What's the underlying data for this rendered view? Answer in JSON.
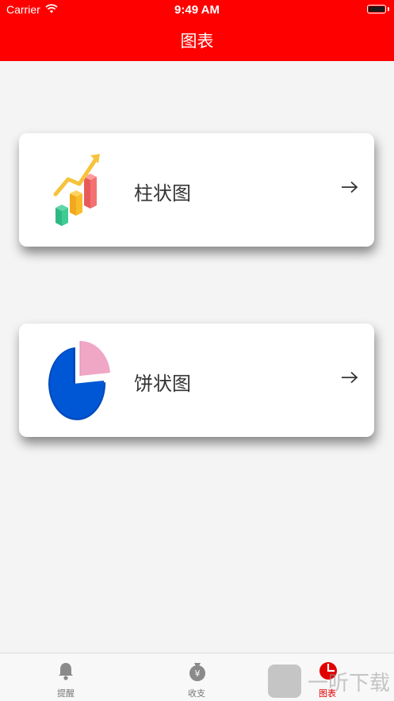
{
  "status_bar": {
    "carrier": "Carrier",
    "time": "9:49 AM"
  },
  "header": {
    "title": "图表"
  },
  "menu": [
    {
      "label": "柱状图",
      "icon": "bar-chart-illustration",
      "action_icon": "arrow-right-icon"
    },
    {
      "label": "饼状图",
      "icon": "pie-chart-illustration",
      "action_icon": "arrow-right-icon"
    }
  ],
  "tabbar": {
    "tabs": [
      {
        "label": "提醒",
        "icon": "bell-icon"
      },
      {
        "label": "收支",
        "icon": "money-bag-icon"
      },
      {
        "label": "图表",
        "icon": "pie-chart-icon",
        "active": true
      }
    ]
  },
  "watermark": {
    "text": "一听下载"
  },
  "colors": {
    "header": "#ff0000",
    "active_tab": "#e00000",
    "background": "#f4f4f4"
  }
}
